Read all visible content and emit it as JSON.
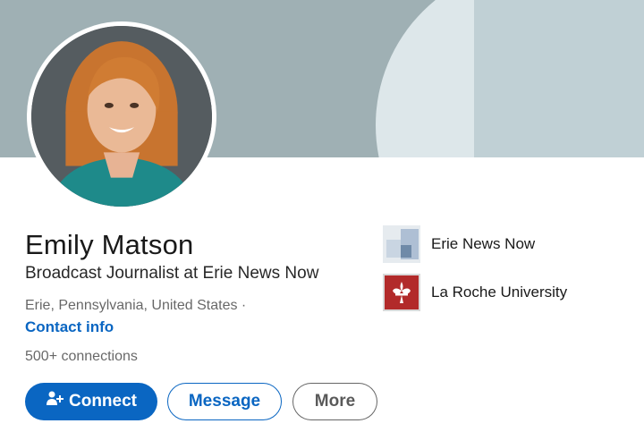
{
  "profile": {
    "name": "Emily Matson",
    "headline": "Broadcast Journalist at Erie News Now",
    "location": "Erie, Pennsylvania, United States ·",
    "contact_info": "Contact info",
    "connections": "500+ connections"
  },
  "actions": {
    "connect_label": "Connect",
    "message_label": "Message",
    "more_label": "More"
  },
  "organizations": [
    {
      "name": "Erie News Now",
      "logo": "erie-news-now-logo"
    },
    {
      "name": "La Roche University",
      "logo": "la-roche-university-logo"
    }
  ],
  "colors": {
    "accent": "#0a66c2",
    "banner": "#9fb0b4"
  }
}
